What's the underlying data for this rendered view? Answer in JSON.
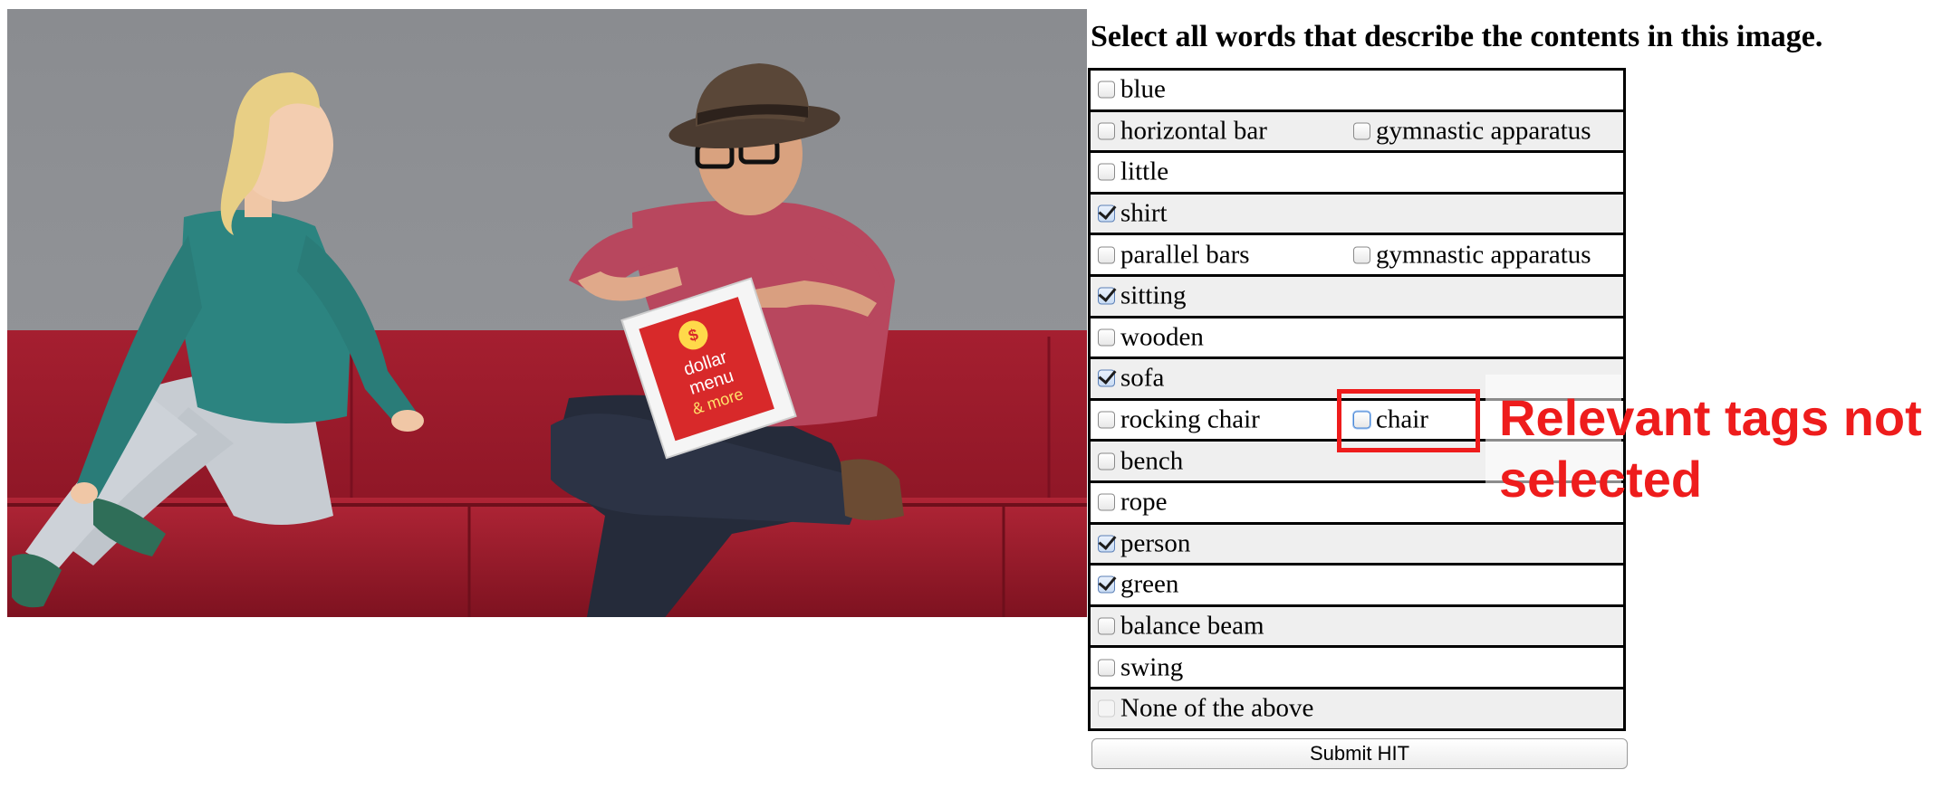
{
  "instruction": "Select all words that describe the contents in this image.",
  "tag_rows": [
    {
      "options": [
        {
          "label": "blue",
          "checked": false
        }
      ]
    },
    {
      "options": [
        {
          "label": "horizontal bar",
          "checked": false
        },
        {
          "label": "gymnastic apparatus",
          "checked": false
        }
      ]
    },
    {
      "options": [
        {
          "label": "little",
          "checked": false
        }
      ]
    },
    {
      "options": [
        {
          "label": "shirt",
          "checked": true
        }
      ]
    },
    {
      "options": [
        {
          "label": "parallel bars",
          "checked": false
        },
        {
          "label": "gymnastic apparatus",
          "checked": false
        }
      ]
    },
    {
      "options": [
        {
          "label": "sitting",
          "checked": true
        }
      ]
    },
    {
      "options": [
        {
          "label": "wooden",
          "checked": false
        }
      ]
    },
    {
      "options": [
        {
          "label": "sofa",
          "checked": true
        }
      ]
    },
    {
      "options": [
        {
          "label": "rocking chair",
          "checked": false
        },
        {
          "label": "chair",
          "checked": false,
          "highlighted": true
        }
      ]
    },
    {
      "options": [
        {
          "label": "bench",
          "checked": false
        }
      ]
    },
    {
      "options": [
        {
          "label": "rope",
          "checked": false
        }
      ]
    },
    {
      "options": [
        {
          "label": "person",
          "checked": true
        }
      ]
    },
    {
      "options": [
        {
          "label": "green",
          "checked": true
        }
      ]
    },
    {
      "options": [
        {
          "label": "balance beam",
          "checked": false
        }
      ]
    },
    {
      "options": [
        {
          "label": "swing",
          "checked": false
        }
      ]
    },
    {
      "options": [
        {
          "label": "None of the above",
          "checked": false,
          "disabled": true
        }
      ]
    }
  ],
  "submit_label": "Submit HIT",
  "annotation": {
    "text": "Relevant tags not selected",
    "color": "#ee1c1c"
  },
  "photo": {
    "bag_logo_lines": [
      "dollar",
      "menu",
      "& more"
    ]
  },
  "colors": {
    "sofa": "#9c1a2b",
    "wall": "#8d8f93",
    "checked_accent": "#5b7fb6"
  }
}
